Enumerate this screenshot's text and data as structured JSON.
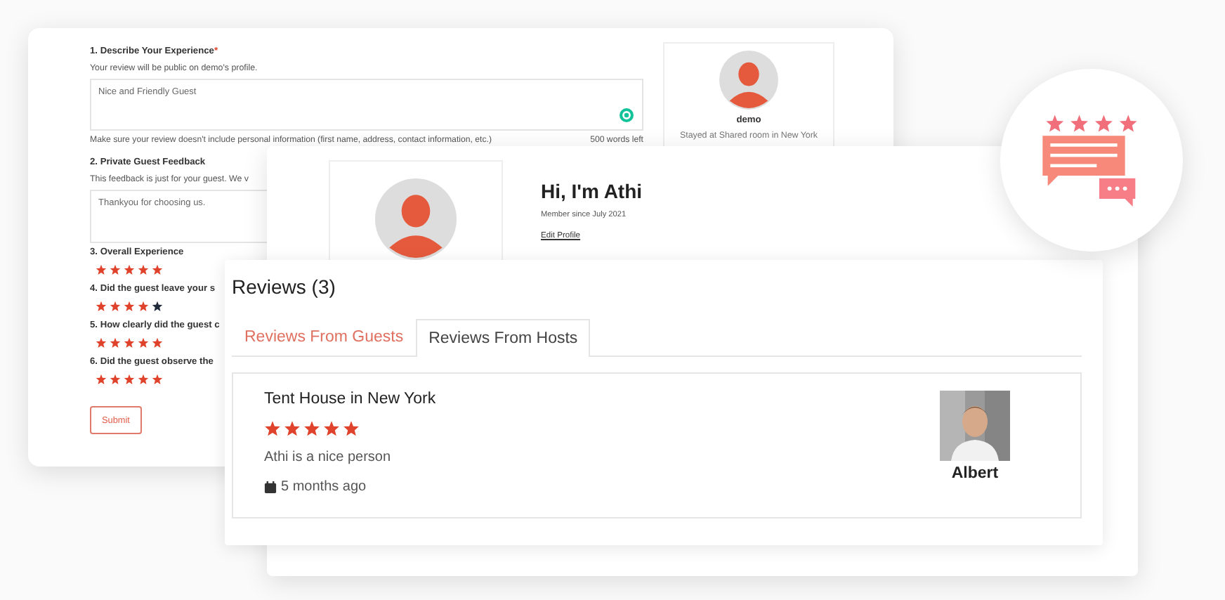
{
  "review_form": {
    "questions": [
      {
        "kind": "text",
        "label": "1. Describe Your Experience",
        "required_mark": "*",
        "hint": "Your review will be public on demo's profile.",
        "value": "Nice and Friendly Guest",
        "note": "Make sure your review doesn't include personal information (first name, address, contact information, etc.)",
        "counter": "500 words left"
      },
      {
        "kind": "text",
        "label": "2. Private Guest Feedback",
        "hint": "This feedback is just for your guest. We v",
        "value": "Thankyou for choosing us."
      },
      {
        "kind": "rating",
        "label": "3. Overall Experience",
        "stars": 5
      },
      {
        "kind": "rating",
        "label": "4. Did the guest leave your s",
        "stars": 4
      },
      {
        "kind": "rating",
        "label": "5. How clearly did the guest c",
        "stars": 5
      },
      {
        "kind": "rating",
        "label": "6. Did the guest observe the",
        "stars": 5
      }
    ],
    "submit": "Submit",
    "guest_card": {
      "name": "demo",
      "stay": "Stayed at Shared room in New York"
    }
  },
  "profile": {
    "greeting": "Hi, I'm Athi",
    "member_since": "Member since July 2021",
    "edit_link": "Edit Profile"
  },
  "reviews": {
    "title": "Reviews (3)",
    "tabs": [
      {
        "label": "Reviews From Guests",
        "selected": false
      },
      {
        "label": "Reviews From Hosts",
        "selected": true
      }
    ],
    "items": [
      {
        "listing": "Tent House in New York",
        "stars": 5,
        "text": "Athi is a nice person",
        "time": "5 months ago",
        "reviewer": "Albert"
      }
    ]
  }
}
